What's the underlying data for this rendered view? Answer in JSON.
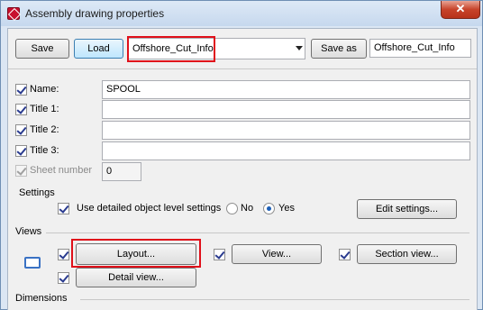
{
  "window": {
    "title": "Assembly drawing properties",
    "close_glyph": "✕"
  },
  "toolbar": {
    "save_label": "Save",
    "load_label": "Load",
    "selected_settings": "Offshore_Cut_Info",
    "save_as_label": "Save as",
    "save_as_value": "Offshore_Cut_Info"
  },
  "fields": {
    "name": {
      "label": "Name:",
      "value": "SPOOL"
    },
    "title1": {
      "label": "Title 1:",
      "value": ""
    },
    "title2": {
      "label": "Title 2:",
      "value": ""
    },
    "title3": {
      "label": "Title 3:",
      "value": ""
    },
    "sheet_number": {
      "label": "Sheet number",
      "value": "0"
    }
  },
  "settings": {
    "heading": "Settings",
    "detailed_label": "Use detailed object level settings",
    "no_label": "No",
    "yes_label": "Yes",
    "edit_label": "Edit settings..."
  },
  "views": {
    "heading": "Views",
    "layout_label": "Layout...",
    "view_label": "View...",
    "section_label": "Section view...",
    "detail_label": "Detail view..."
  },
  "dimensions": {
    "heading": "Dimensions"
  },
  "colors": {
    "highlight": "#e0101a",
    "accent": "#3a72c4"
  }
}
